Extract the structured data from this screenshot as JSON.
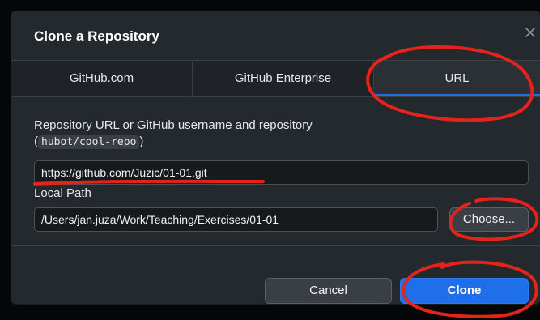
{
  "dialog": {
    "title": "Clone a Repository",
    "close_icon": "close-icon"
  },
  "tabs": [
    {
      "label": "GitHub.com",
      "active": false
    },
    {
      "label": "GitHub Enterprise",
      "active": false
    },
    {
      "label": "URL",
      "active": true
    }
  ],
  "form": {
    "repo_label": "Repository URL or GitHub username and repository",
    "repo_hint_open": "(",
    "repo_hint_code": "hubot/cool-repo",
    "repo_hint_close": ")",
    "repo_value": "https://github.com/Juzic/01-01.git",
    "local_path_label": "Local Path",
    "local_path_value": "/Users/jan.juza/Work/Teaching/Exercises/01-01",
    "choose_label": "Choose..."
  },
  "footer": {
    "cancel_label": "Cancel",
    "clone_label": "Clone"
  },
  "colors": {
    "accent": "#1f6feb",
    "annotation": "#e5231b"
  }
}
